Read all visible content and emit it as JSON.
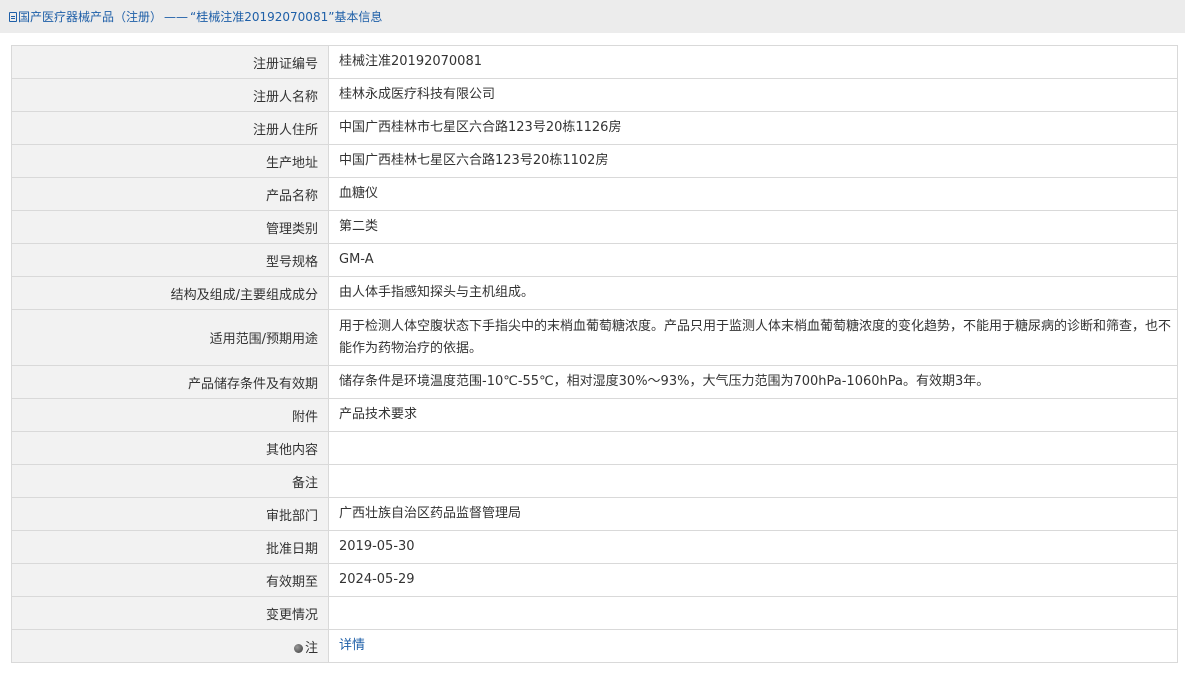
{
  "breadcrumb": {
    "category": "国产医疗器械产品（注册）",
    "separator": "——",
    "record": "“桂械注准20192070081”基本信息"
  },
  "rows": [
    {
      "label": "注册证编号",
      "value": "桂械注准20192070081"
    },
    {
      "label": "注册人名称",
      "value": "桂林永成医疗科技有限公司"
    },
    {
      "label": "注册人住所",
      "value": "中国广西桂林市七星区六合路123号20栋1126房"
    },
    {
      "label": "生产地址",
      "value": "中国广西桂林七星区六合路123号20栋1102房"
    },
    {
      "label": "产品名称",
      "value": "血糖仪"
    },
    {
      "label": "管理类别",
      "value": "第二类"
    },
    {
      "label": "型号规格",
      "value": "GM-A"
    },
    {
      "label": "结构及组成/主要组成成分",
      "value": "由人体手指感知探头与主机组成。"
    },
    {
      "label": "适用范围/预期用途",
      "value": "用于检测人体空腹状态下手指尖中的末梢血葡萄糖浓度。产品只用于监测人体末梢血葡萄糖浓度的变化趋势，不能用于糖尿病的诊断和筛查，也不能作为药物治疗的依据。"
    },
    {
      "label": "产品储存条件及有效期",
      "value": "储存条件是环境温度范围-10℃-55℃，相对湿度30%～93%，大气压力范围为700hPa-1060hPa。有效期3年。"
    },
    {
      "label": "附件",
      "value": "产品技术要求"
    },
    {
      "label": "其他内容",
      "value": ""
    },
    {
      "label": "备注",
      "value": ""
    },
    {
      "label": "审批部门",
      "value": "广西壮族自治区药品监督管理局"
    },
    {
      "label": "批准日期",
      "value": "2019-05-30"
    },
    {
      "label": "有效期至",
      "value": "2024-05-29"
    },
    {
      "label": "变更情况",
      "value": ""
    }
  ],
  "note_row": {
    "label": "注",
    "link_text": "详情"
  },
  "colors": {
    "link": "#1e5fa8",
    "label_bg": "#f2f2f2",
    "border": "#d9d9d9",
    "titlebar_bg": "#ececec"
  }
}
